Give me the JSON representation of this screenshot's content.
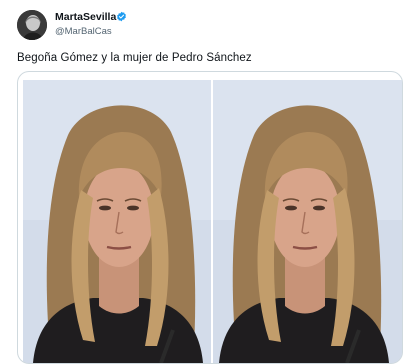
{
  "author": {
    "name": "MartaSevilla",
    "handle": "@MarBalCas",
    "verified_icon": "verified-badge-icon",
    "avatar_icon": "avatar-image"
  },
  "tweet": {
    "text": "Begoña Gómez y la mujer de Pedro Sánchez"
  },
  "media": {
    "count": 2,
    "images": [
      {
        "icon": "portrait-photo"
      },
      {
        "icon": "portrait-photo"
      }
    ]
  },
  "colors": {
    "text": "#0f1419",
    "secondary": "#536471",
    "verified": "#1d9bf0",
    "border": "#cfd9de"
  }
}
